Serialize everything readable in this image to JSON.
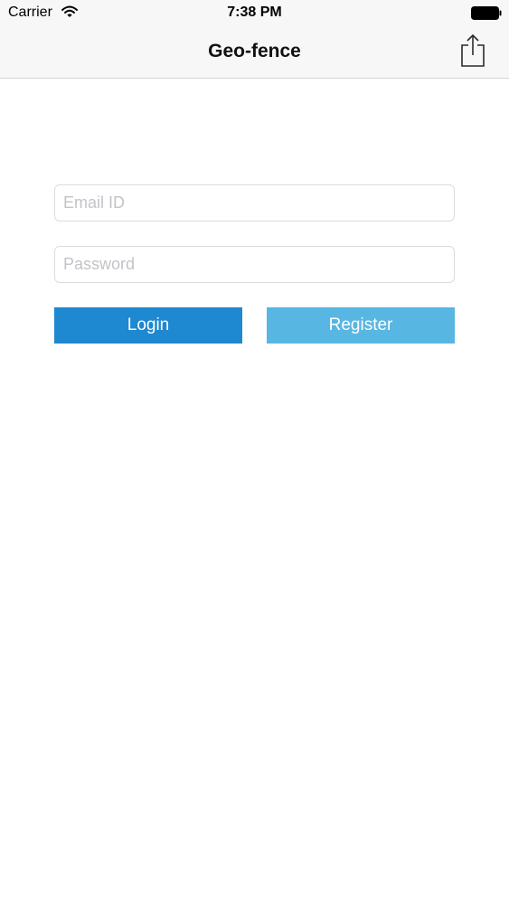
{
  "status_bar": {
    "carrier": "Carrier",
    "time": "7:38 PM",
    "icons": [
      "wifi-icon",
      "battery-icon"
    ]
  },
  "nav_bar": {
    "title": "Geo-fence",
    "share_icon": "share-icon"
  },
  "form": {
    "email_placeholder": "Email ID",
    "email_value": "",
    "password_placeholder": "Password",
    "password_value": "",
    "login_label": "Login",
    "register_label": "Register"
  },
  "colors": {
    "login_button": "#1e88d0",
    "register_button": "#58b6e2",
    "bar_background": "#f7f7f8"
  }
}
